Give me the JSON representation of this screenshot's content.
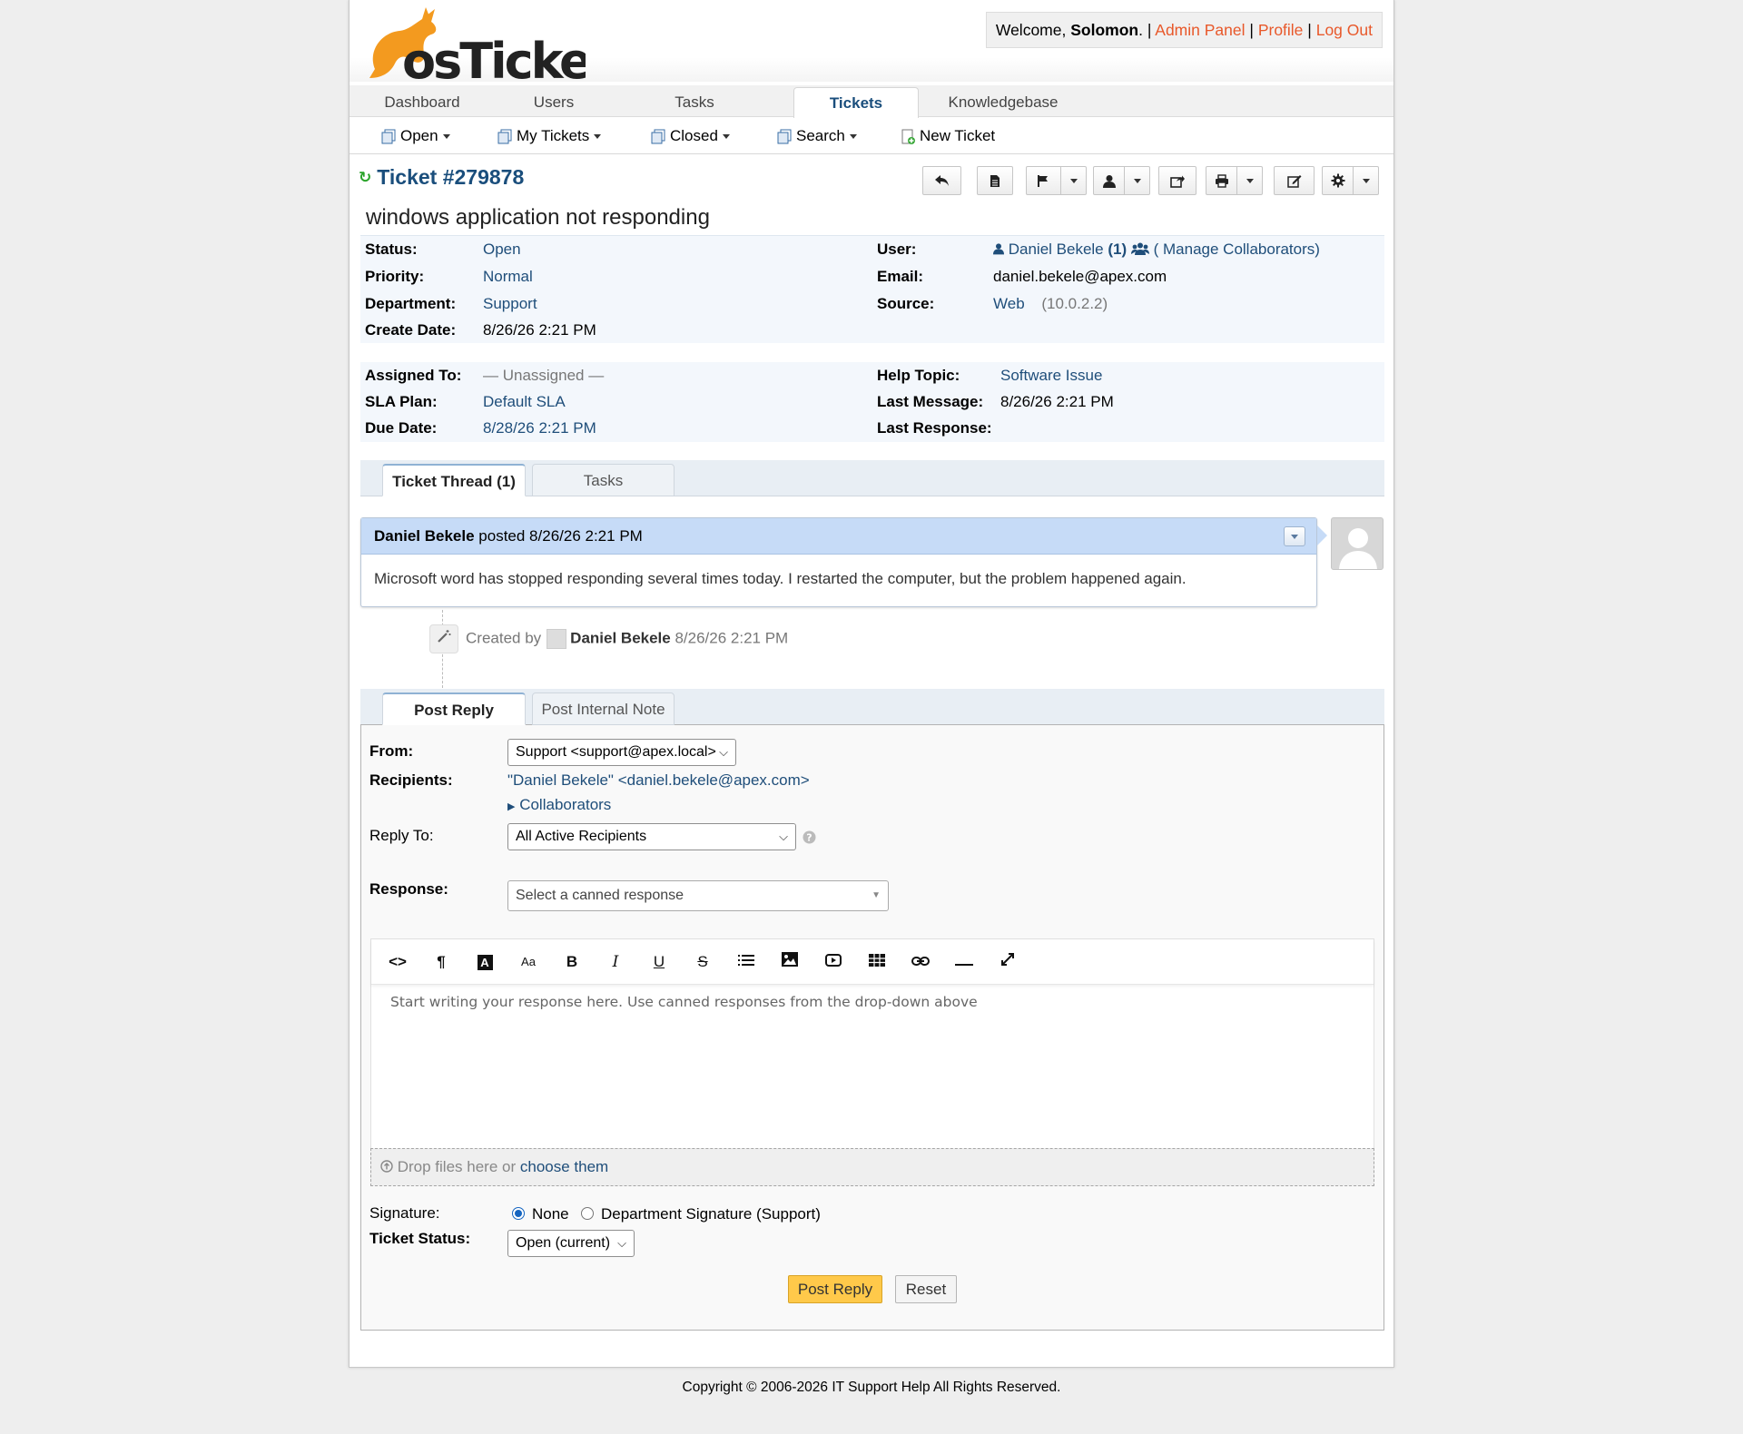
{
  "header": {
    "logo_text": "osTicket",
    "welcome_prefix": "Welcome,",
    "user_name": "Solomon",
    "welcome_suffix": ". |",
    "admin_panel": "Admin Panel",
    "profile": "Profile",
    "logout": "Log Out",
    "sep": "|"
  },
  "nav": {
    "tabs": [
      "Dashboard",
      "Users",
      "Tasks",
      "Tickets",
      "Knowledgebase"
    ],
    "active": "Tickets"
  },
  "subnav": {
    "open": "Open",
    "my_tickets": "My Tickets",
    "closed": "Closed",
    "search": "Search",
    "new_ticket": "New Ticket"
  },
  "ticket": {
    "number": "Ticket #279878",
    "subject": "windows application not responding",
    "status_label": "Status:",
    "status": "Open",
    "priority_label": "Priority:",
    "priority": "Normal",
    "department_label": "Department:",
    "department": "Support",
    "create_date_label": "Create Date:",
    "create_date": "8/26/26 2:21 PM",
    "user_label": "User:",
    "user": "Daniel Bekele",
    "user_count": "(1)",
    "manage_collaborators": "( Manage Collaborators)",
    "email_label": "Email:",
    "email": "daniel.bekele@apex.com",
    "source_label": "Source:",
    "source": "Web",
    "source_ip": "(10.0.2.2)",
    "assigned_label": "Assigned To:",
    "assigned": "— Unassigned —",
    "sla_label": "SLA Plan:",
    "sla": "Default SLA",
    "due_label": "Due Date:",
    "due": "8/28/26 2:21 PM",
    "help_topic_label": "Help Topic:",
    "help_topic": "Software Issue",
    "last_message_label": "Last Message:",
    "last_message": "8/26/26 2:21 PM",
    "last_response_label": "Last Response:",
    "last_response": ""
  },
  "thread_tabs": {
    "thread": "Ticket Thread (1)",
    "tasks": "Tasks"
  },
  "thread": {
    "author": "Daniel Bekele",
    "posted": "posted 8/26/26 2:21 PM",
    "body": "Microsoft word has stopped responding several times today. I restarted the computer, but the problem happened again.",
    "event_prefix": "Created by",
    "event_author": "Daniel Bekele",
    "event_time": "8/26/26 2:21 PM"
  },
  "reply_tabs": {
    "post_reply": "Post Reply",
    "internal_note": "Post Internal Note"
  },
  "reply": {
    "from_label": "From:",
    "from_value": "Support <support@apex.local>",
    "recipients_label": "Recipients:",
    "recipients_value": "\"Daniel Bekele\" <daniel.bekele@apex.com>",
    "collaborators": "Collaborators",
    "reply_to_label": "Reply To:",
    "reply_to_value": "All Active Recipients",
    "response_label": "Response:",
    "response_placeholder": "Select a canned response",
    "editor_placeholder": "Start writing your response here. Use canned responses from the drop-down above",
    "drop_text": "Drop files here or",
    "choose_them": "choose them",
    "signature_label": "Signature:",
    "signature_none": "None",
    "signature_dept": "Department Signature (Support)",
    "status_label": "Ticket Status:",
    "status_value": "Open (current)",
    "post_button": "Post Reply",
    "reset_button": "Reset"
  },
  "footer": {
    "copyright": "Copyright © 2006-2026 IT Support Help All Rights Reserved."
  },
  "colors": {
    "accent": "#1a4e7c",
    "link_orange": "#e8582a",
    "logo_orange": "#f39a1f",
    "thread_header": "#c6dbf7",
    "post_button": "#ffc94a"
  }
}
